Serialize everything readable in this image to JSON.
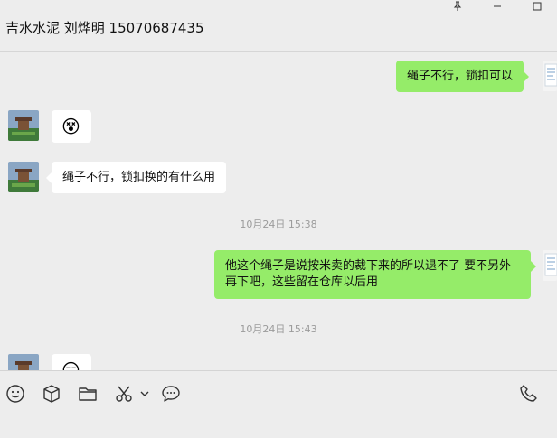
{
  "window": {
    "title": "吉水水泥 刘烨明 15070687435",
    "controls": {
      "pin_icon": "pin-icon",
      "minimize_icon": "minimize-icon",
      "maximize_icon": "maximize-icon"
    }
  },
  "messages": [
    {
      "side": "out",
      "text": "绳子不行，锁扣可以"
    },
    {
      "side": "in",
      "type": "emoji",
      "emoji": "😵"
    },
    {
      "side": "in",
      "text": "绳子不行，锁扣换的有什么用"
    },
    {
      "type": "time",
      "text": "10月24日 15:38"
    },
    {
      "side": "out",
      "text": "他这个绳子是说按米卖的裁下来的所以退不了 要不另外再下吧，这些留在仓库以后用"
    },
    {
      "type": "time",
      "text": "10月24日 15:43"
    },
    {
      "side": "in",
      "type": "emoji",
      "emoji": "😑"
    }
  ],
  "toolbar": {
    "icons": [
      "emoji-icon",
      "package-icon",
      "folder-icon",
      "scissors-icon",
      "chevron-down-icon",
      "chat-bubble-icon",
      "phone-icon"
    ]
  },
  "colors": {
    "out_bubble": "#95ec69",
    "in_bubble": "#ffffff",
    "background": "#ededed"
  }
}
